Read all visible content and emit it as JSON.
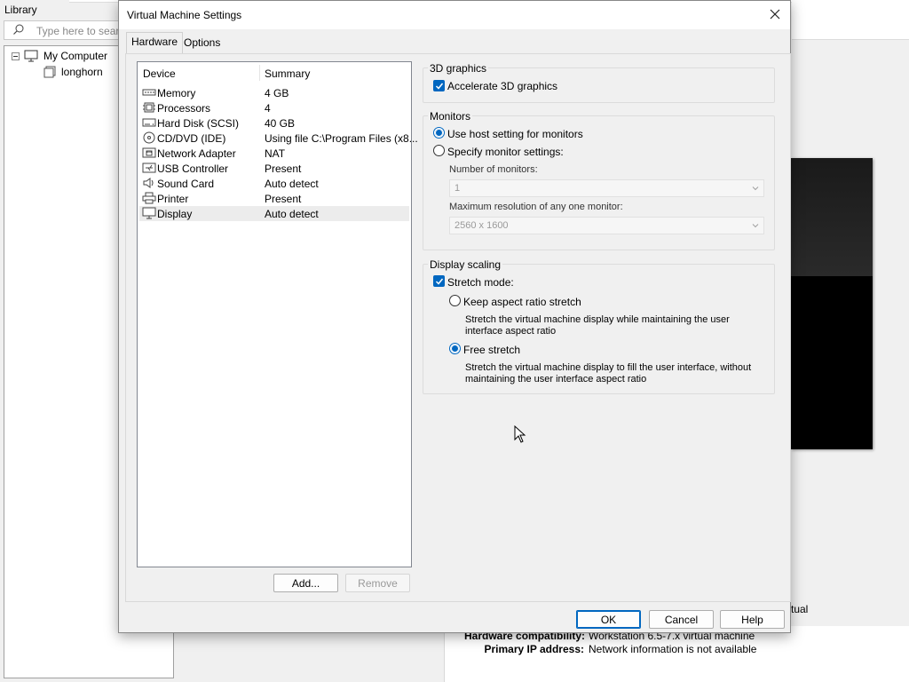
{
  "library": {
    "title": "Library",
    "search_placeholder": "Type here to search",
    "tree": [
      {
        "label": "My Computer"
      },
      {
        "label": "longhorn"
      }
    ]
  },
  "background_info": {
    "partial_text": "tual",
    "hardware_compat_label": "Hardware compatibility:",
    "hardware_compat_value": "Workstation 6.5-7.x virtual machine",
    "primary_ip_label": "Primary IP address:",
    "primary_ip_value": "Network information is not available"
  },
  "dialog": {
    "title": "Virtual Machine Settings",
    "tabs": [
      {
        "label": "Hardware",
        "active": true
      },
      {
        "label": "Options",
        "active": false
      }
    ],
    "device_list": {
      "headers": {
        "device": "Device",
        "summary": "Summary"
      },
      "rows": [
        {
          "icon": "memory-icon",
          "device": "Memory",
          "summary": "4 GB"
        },
        {
          "icon": "processor-icon",
          "device": "Processors",
          "summary": "4"
        },
        {
          "icon": "hard-disk-icon",
          "device": "Hard Disk (SCSI)",
          "summary": "40 GB"
        },
        {
          "icon": "cd-dvd-icon",
          "device": "CD/DVD (IDE)",
          "summary": "Using file C:\\Program Files (x8..."
        },
        {
          "icon": "network-adapter-icon",
          "device": "Network Adapter",
          "summary": "NAT"
        },
        {
          "icon": "usb-icon",
          "device": "USB Controller",
          "summary": "Present"
        },
        {
          "icon": "sound-card-icon",
          "device": "Sound Card",
          "summary": "Auto detect"
        },
        {
          "icon": "printer-icon",
          "device": "Printer",
          "summary": "Present"
        },
        {
          "icon": "display-icon",
          "device": "Display",
          "summary": "Auto detect",
          "selected": true
        }
      ]
    },
    "buttons": {
      "add": "Add...",
      "remove": "Remove",
      "ok": "OK",
      "cancel": "Cancel",
      "help": "Help"
    },
    "graphics_3d": {
      "label": "3D graphics",
      "accelerate": {
        "label": "Accelerate 3D graphics",
        "checked": true
      }
    },
    "monitors": {
      "label": "Monitors",
      "use_host": {
        "label": "Use host setting for monitors",
        "checked": true
      },
      "specify": {
        "label": "Specify monitor settings:",
        "checked": false
      },
      "num_monitors_label": "Number of monitors:",
      "num_monitors_value": "1",
      "max_res_label": "Maximum resolution of any one monitor:",
      "max_res_value": "2560 x 1600"
    },
    "display_scaling": {
      "label": "Display scaling",
      "stretch_mode": {
        "label": "Stretch mode:",
        "checked": true
      },
      "keep_aspect": {
        "label": "Keep aspect ratio stretch",
        "checked": false,
        "desc1": "Stretch the virtual machine display while maintaining the user",
        "desc2": "interface aspect ratio"
      },
      "free_stretch": {
        "label": "Free stretch",
        "checked": true,
        "desc1": "Stretch the virtual machine display to fill the user interface, without",
        "desc2": "maintaining the user interface aspect ratio"
      }
    }
  },
  "colors": {
    "accent": "#0067c0",
    "dialog_bg": "#f0f0f0",
    "selected_row": "#ececec"
  }
}
